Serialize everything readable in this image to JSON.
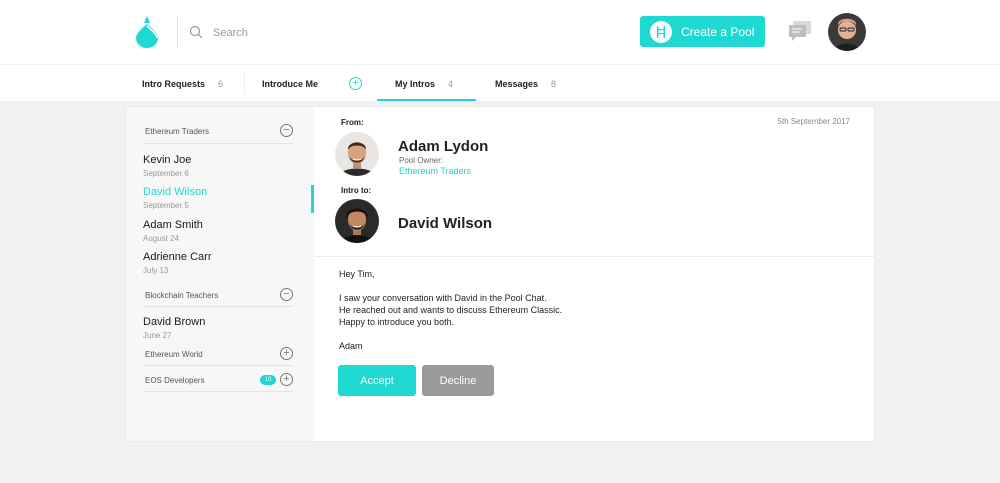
{
  "header": {
    "search_placeholder": "Search",
    "create_pool_label": "Create a Pool",
    "accent": "#1fd8d2",
    "icons": [
      "drop-logo-icon",
      "search-icon",
      "pool-icon",
      "chat-icon"
    ]
  },
  "tabs": [
    {
      "label": "Intro Requests",
      "count": "6"
    },
    {
      "label": "Introduce Me",
      "count": ""
    },
    {
      "label": "My Intros",
      "count": "4",
      "active": true
    },
    {
      "label": "Messages",
      "count": "8"
    }
  ],
  "sidebar": {
    "groups": [
      {
        "name": "Ethereum Traders",
        "expanded": true
      },
      {
        "name": "Blockchain Teachers",
        "expanded": true
      },
      {
        "name": "Ethereum World",
        "expanded": false
      },
      {
        "name": "EOS Developers",
        "expanded": false,
        "badge": "10"
      }
    ],
    "items": [
      {
        "name": "Kevin Joe",
        "date": "September 6"
      },
      {
        "name": "David Wilson",
        "date": "September 5",
        "active": true
      },
      {
        "name": "Adam Smith",
        "date": "August 24"
      },
      {
        "name": "Adrienne Carr",
        "date": "July 13"
      },
      {
        "name": "David Brown",
        "date": "June 27"
      }
    ]
  },
  "intro": {
    "from_label": "From:",
    "date": "5th September 2017",
    "from_name": "Adam Lydon",
    "pool_owner_label": "Pool Owner:",
    "pool_name": "Ethereum Traders",
    "to_label": "Intro to:",
    "to_name": "David Wilson",
    "message": {
      "greeting": "Hey Tim,",
      "line1": "I saw your conversation with David in the Pool Chat.",
      "line2": "He reached out and wants to discuss Ethereum Classic.",
      "line3": "Happy to introduce you both.",
      "signature": "Adam"
    },
    "accept_label": "Accept",
    "decline_label": "Decline"
  }
}
